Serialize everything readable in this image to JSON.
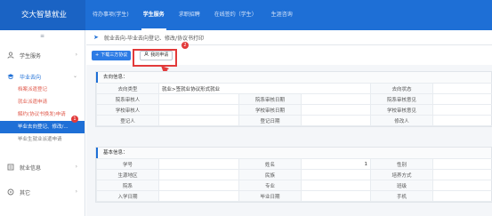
{
  "app": {
    "title": "交大智慧就业"
  },
  "topnav": {
    "items": [
      {
        "label": "待办事项(学生)",
        "active": false
      },
      {
        "label": "学生服务",
        "active": true
      },
      {
        "label": "求职招聘",
        "active": false
      },
      {
        "label": "在线签约（学生）",
        "active": false
      },
      {
        "label": "生涯咨询",
        "active": false
      }
    ]
  },
  "sidebar": {
    "collapse_icon": "≡",
    "groups": [
      {
        "label": "学生服务",
        "icon": "student-icon",
        "open": false
      },
      {
        "label": "毕业去向",
        "icon": "graduation-icon",
        "open": true
      },
      {
        "label": "就业信息",
        "icon": "info-icon",
        "open": false
      },
      {
        "label": "其它",
        "icon": "other-icon",
        "open": false
      }
    ],
    "sub_items": [
      {
        "label": "档案派遣登记"
      },
      {
        "label": "就业派遣申请"
      },
      {
        "label": "解约(协议书换发)申请"
      },
      {
        "label": "毕业去向登记、修改/...",
        "active": true,
        "badge": "1"
      },
      {
        "label": "毕业生就业派遣申请"
      }
    ]
  },
  "main": {
    "breadcrumb": "就业去向-毕业去向登记、修改/协议书打印",
    "toolbar": {
      "download_label": "下载三方协议",
      "my_apply_label": "我的申请",
      "step_badge": "2"
    },
    "panel1": {
      "title": "去向信息：",
      "rows": [
        [
          "去向类型",
          "就业>签就业协议形式就业",
          "",
          "",
          "去向状态",
          ""
        ],
        [
          "院系审核人",
          "",
          "院系审核日期",
          "",
          "院系审核意见",
          ""
        ],
        [
          "学校审核人",
          "",
          "学校审核日期",
          "",
          "学校审核意见",
          ""
        ],
        [
          "登记人",
          "",
          "登记日期",
          "",
          "修改人",
          ""
        ]
      ]
    },
    "panel2": {
      "title": "基本信息：",
      "rows": [
        [
          "学号",
          "",
          "姓名",
          "1",
          "性别",
          ""
        ],
        [
          "生源地区",
          "",
          "民族",
          "",
          "培养方式",
          ""
        ],
        [
          "院系",
          "",
          "专业",
          "",
          "班级",
          ""
        ],
        [
          "入学日期",
          "",
          "毕业日期",
          "",
          "手机",
          ""
        ]
      ]
    }
  },
  "colors": {
    "brand": "#1e6fd6",
    "highlight": "#e23a3a"
  }
}
